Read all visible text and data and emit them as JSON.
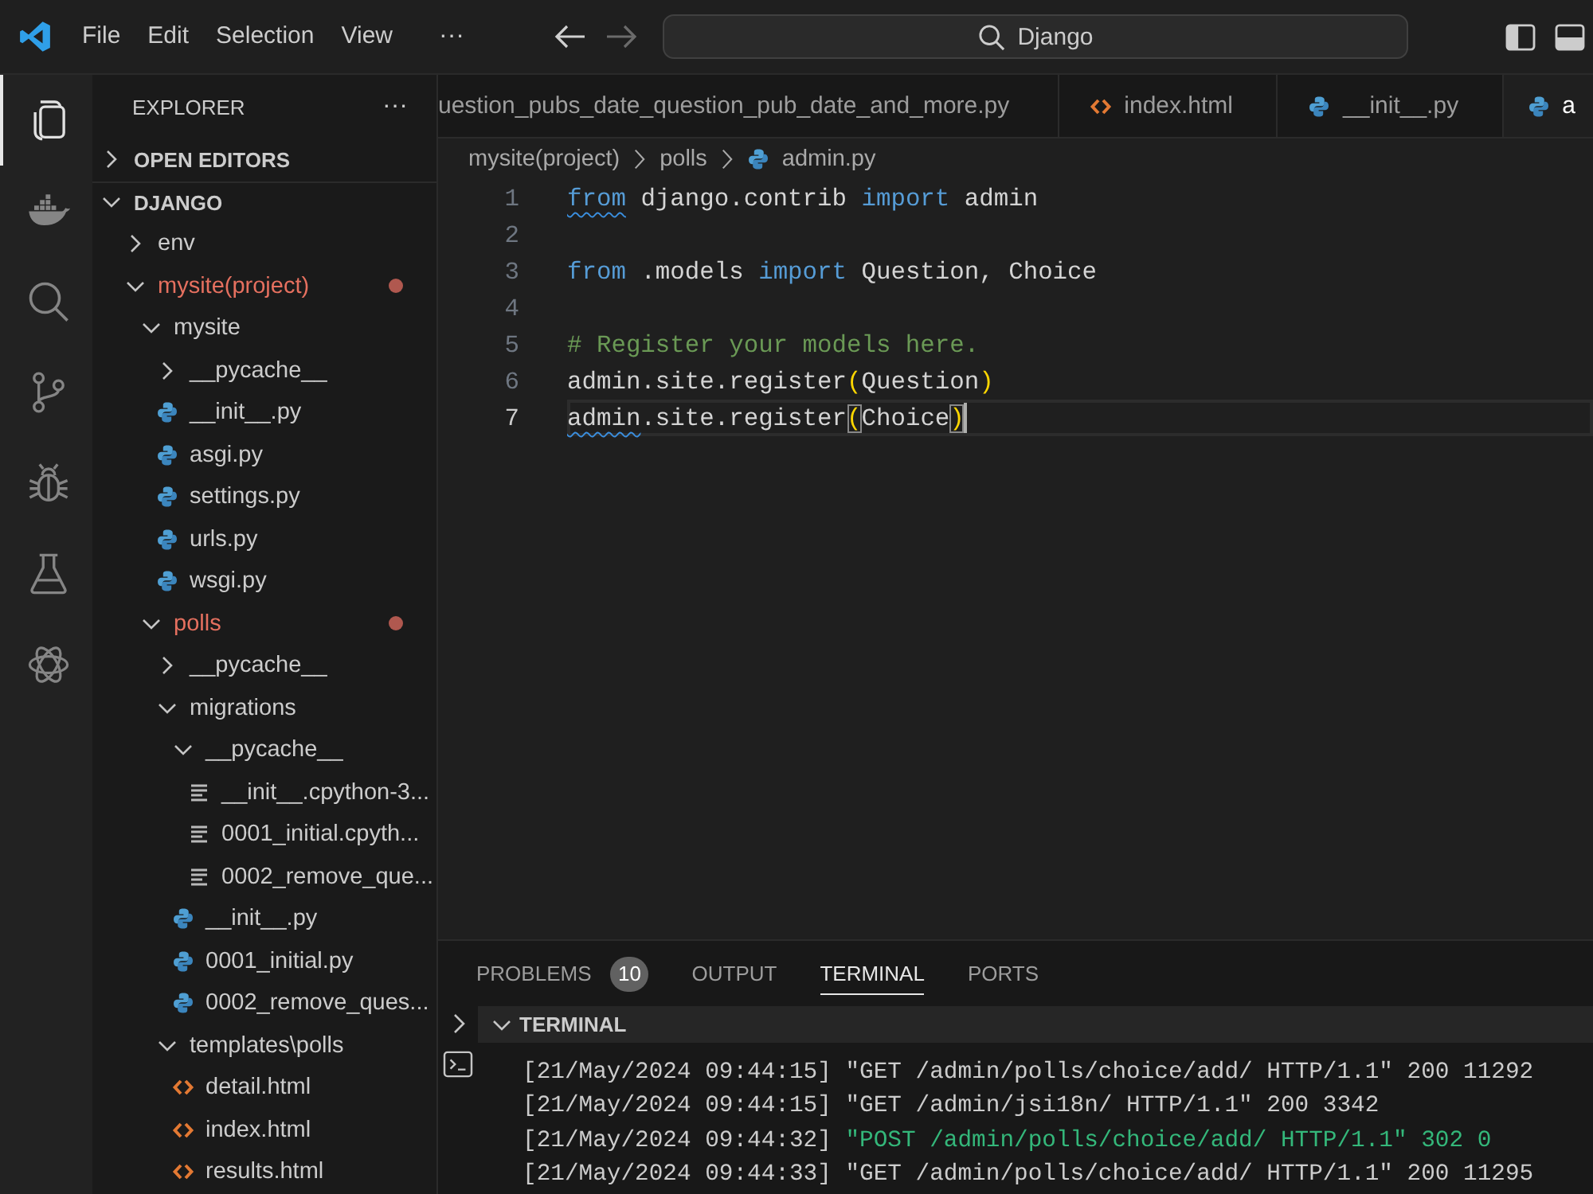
{
  "title_bar": {
    "menus": [
      "File",
      "Edit",
      "Selection",
      "View"
    ],
    "more": "···",
    "nav": [
      {
        "kind": "back",
        "disabled": false
      },
      {
        "kind": "forward",
        "disabled": true
      }
    ],
    "search": {
      "label": "Django"
    },
    "layout_toggles": [
      {
        "kind": "sidebar",
        "on": true
      },
      {
        "kind": "panel",
        "on": true
      }
    ]
  },
  "activity_bar": {
    "items": [
      {
        "kind": "files",
        "selected": true
      },
      {
        "kind": "whale",
        "selected": false
      },
      {
        "kind": "search",
        "selected": false
      },
      {
        "kind": "branch",
        "selected": false
      },
      {
        "kind": "bug",
        "selected": false
      },
      {
        "kind": "flask",
        "selected": false
      },
      {
        "kind": "atom",
        "selected": false
      }
    ]
  },
  "explorer": {
    "title": "EXPLORER",
    "more": "···",
    "sections": [
      {
        "label": "OPEN EDITORS",
        "kind": "section",
        "expanded": false,
        "modified": false
      },
      {
        "label": "DJANGO",
        "kind": "section",
        "expanded": true,
        "modified": false,
        "children": [
          {
            "label": "env",
            "kind": "folder",
            "expanded": false,
            "modified": false
          },
          {
            "label": "mysite(project)",
            "kind": "folder",
            "expanded": true,
            "modified": true,
            "children": [
              {
                "label": "mysite",
                "kind": "folder",
                "expanded": true,
                "modified": false,
                "children": [
                  {
                    "label": "__pycache__",
                    "kind": "folder",
                    "expanded": false,
                    "modified": false
                  },
                  {
                    "label": "__init__.py",
                    "kind": "python",
                    "modified": false
                  },
                  {
                    "label": "asgi.py",
                    "kind": "python",
                    "modified": false
                  },
                  {
                    "label": "settings.py",
                    "kind": "python",
                    "modified": false
                  },
                  {
                    "label": "urls.py",
                    "kind": "python",
                    "modified": false
                  },
                  {
                    "label": "wsgi.py",
                    "kind": "python",
                    "modified": false
                  }
                ]
              },
              {
                "label": "polls",
                "kind": "folder",
                "expanded": true,
                "modified": true,
                "children": [
                  {
                    "label": "__pycache__",
                    "kind": "folder",
                    "expanded": false,
                    "modified": false
                  },
                  {
                    "label": "migrations",
                    "kind": "folder",
                    "expanded": true,
                    "modified": false,
                    "children": [
                      {
                        "label": "__pycache__",
                        "kind": "folder",
                        "expanded": true,
                        "modified": false,
                        "children": [
                          {
                            "label": "__init__.cpython-3...",
                            "kind": "compiled",
                            "modified": false
                          },
                          {
                            "label": "0001_initial.cpyth...",
                            "kind": "compiled",
                            "modified": false
                          },
                          {
                            "label": "0002_remove_que...",
                            "kind": "compiled",
                            "modified": false
                          }
                        ]
                      },
                      {
                        "label": "__init__.py",
                        "kind": "python",
                        "modified": false
                      },
                      {
                        "label": "0001_initial.py",
                        "kind": "python",
                        "modified": false
                      },
                      {
                        "label": "0002_remove_ques...",
                        "kind": "python",
                        "modified": false
                      }
                    ]
                  },
                  {
                    "label": "templates\\polls",
                    "kind": "folder",
                    "expanded": true,
                    "modified": false,
                    "children": [
                      {
                        "label": "detail.html",
                        "kind": "html",
                        "modified": false
                      },
                      {
                        "label": "index.html",
                        "kind": "html",
                        "modified": false
                      },
                      {
                        "label": "results.html",
                        "kind": "html",
                        "modified": false
                      }
                    ]
                  }
                ]
              }
            ]
          }
        ]
      }
    ]
  },
  "editor": {
    "tabs": [
      {
        "label": "uestion_pubs_date_question_pub_date_and_more.py",
        "kind": "scrolled",
        "selected": false
      },
      {
        "label": "index.html",
        "kind": "html",
        "selected": false
      },
      {
        "label": "__init__.py",
        "kind": "python",
        "selected": false
      },
      {
        "label": "a",
        "kind": "python",
        "selected": true
      }
    ],
    "breadcrumb": [
      {
        "label": "mysite(project)",
        "kind": "folder"
      },
      {
        "label": "polls",
        "kind": "folder"
      },
      {
        "label": "admin.py",
        "kind": "python"
      }
    ],
    "lines": [
      {
        "number": "1",
        "current": false,
        "cursor": false,
        "tokens": [
          {
            "text": "from",
            "kind": "keyword",
            "squiggle": true,
            "matched": false
          },
          {
            "text": " django.contrib ",
            "kind": "plain",
            "squiggle": false,
            "matched": false
          },
          {
            "text": "import",
            "kind": "keyword",
            "squiggle": false,
            "matched": false
          },
          {
            "text": " admin",
            "kind": "plain",
            "squiggle": false,
            "matched": false
          }
        ]
      },
      {
        "number": "2",
        "current": false,
        "cursor": false
      },
      {
        "number": "3",
        "current": false,
        "cursor": false,
        "tokens": [
          {
            "text": "from",
            "kind": "keyword",
            "squiggle": false,
            "matched": false
          },
          {
            "text": " .models ",
            "kind": "plain",
            "squiggle": false,
            "matched": false
          },
          {
            "text": "import",
            "kind": "keyword",
            "squiggle": false,
            "matched": false
          },
          {
            "text": " Question, Choice",
            "kind": "plain",
            "squiggle": false,
            "matched": false
          }
        ]
      },
      {
        "number": "4",
        "current": false,
        "cursor": false
      },
      {
        "number": "5",
        "current": false,
        "cursor": false,
        "tokens": [
          {
            "text": "# Register your models here.",
            "kind": "comment",
            "squiggle": false,
            "matched": false
          }
        ]
      },
      {
        "number": "6",
        "current": false,
        "cursor": false,
        "tokens": [
          {
            "text": "admin.site.register",
            "kind": "plain",
            "squiggle": false,
            "matched": false
          },
          {
            "text": "(",
            "kind": "bracket",
            "squiggle": false,
            "matched": false
          },
          {
            "text": "Question",
            "kind": "plain",
            "squiggle": false,
            "matched": false
          },
          {
            "text": ")",
            "kind": "bracket",
            "squiggle": false,
            "matched": false
          }
        ]
      },
      {
        "number": "7",
        "current": true,
        "cursor": true,
        "tokens": [
          {
            "text": "admin",
            "kind": "plain",
            "squiggle": true,
            "matched": false
          },
          {
            "text": ".site.register",
            "kind": "plain",
            "squiggle": false,
            "matched": false
          },
          {
            "text": "(",
            "kind": "bracket",
            "squiggle": false,
            "matched": true
          },
          {
            "text": "Choice",
            "kind": "plain",
            "squiggle": false,
            "matched": false
          },
          {
            "text": ")",
            "kind": "bracket",
            "squiggle": false,
            "matched": true
          }
        ]
      }
    ]
  },
  "panel": {
    "tabs": [
      {
        "label": "PROBLEMS",
        "badge": "10",
        "selected": false
      },
      {
        "label": "OUTPUT",
        "selected": false
      },
      {
        "label": "TERMINAL",
        "selected": true
      },
      {
        "label": "PORTS",
        "selected": false
      }
    ],
    "terminal": {
      "title": "TERMINAL",
      "expanded": true,
      "lines": [
        {
          "time": "[21/May/2024 09:44:15]",
          "message": "\"GET /admin/polls/choice/add/ HTTP/1.1\" 200 11292",
          "kind": "success"
        },
        {
          "time": "[21/May/2024 09:44:15]",
          "message": "\"GET /admin/jsi18n/ HTTP/1.1\" 200 3342",
          "kind": "success"
        },
        {
          "time": "[21/May/2024 09:44:32]",
          "message": "\"POST /admin/polls/choice/add/ HTTP/1.1\" 302 0",
          "kind": "redirect"
        },
        {
          "time": "[21/May/2024 09:44:33]",
          "message": "\"GET /admin/polls/choice/add/ HTTP/1.1\" 200 11295",
          "kind": "success"
        }
      ]
    }
  }
}
